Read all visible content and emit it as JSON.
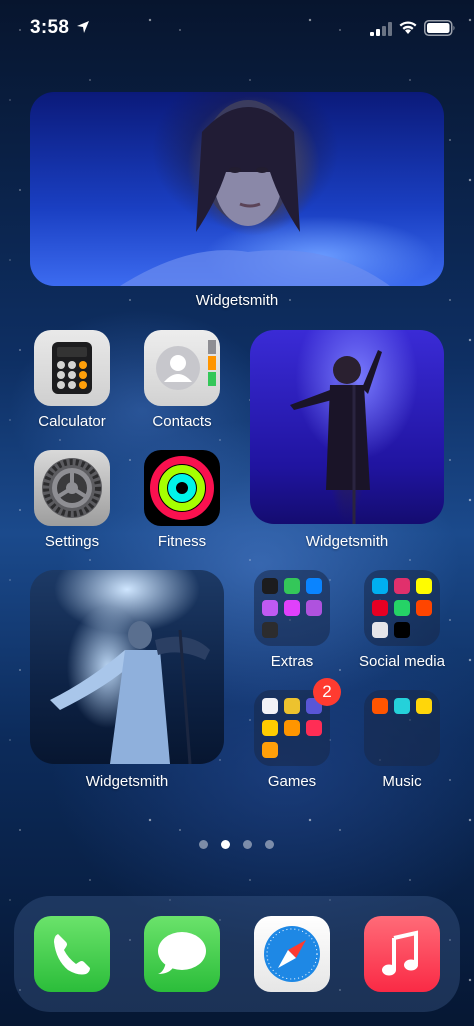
{
  "status_bar": {
    "time": "3:58"
  },
  "widgets": [
    {
      "label": "Widgetsmith"
    },
    {
      "label": "Widgetsmith"
    },
    {
      "label": "Widgetsmith"
    }
  ],
  "apps": {
    "calculator": "Calculator",
    "contacts": "Contacts",
    "settings": "Settings",
    "fitness": "Fitness"
  },
  "folders": {
    "extras": "Extras",
    "social_media": "Social media",
    "games": "Games",
    "music": "Music"
  },
  "games_badge": "2",
  "page_indicator": {
    "pages": 4,
    "current": 2
  },
  "dock": [
    "Phone",
    "Messages",
    "Safari",
    "Music"
  ],
  "colors": {
    "wallpaper": "#0e2f63",
    "badge": "#ff3b30",
    "phone_green": "#2bbd3a",
    "music_red": "#fa2a45"
  }
}
